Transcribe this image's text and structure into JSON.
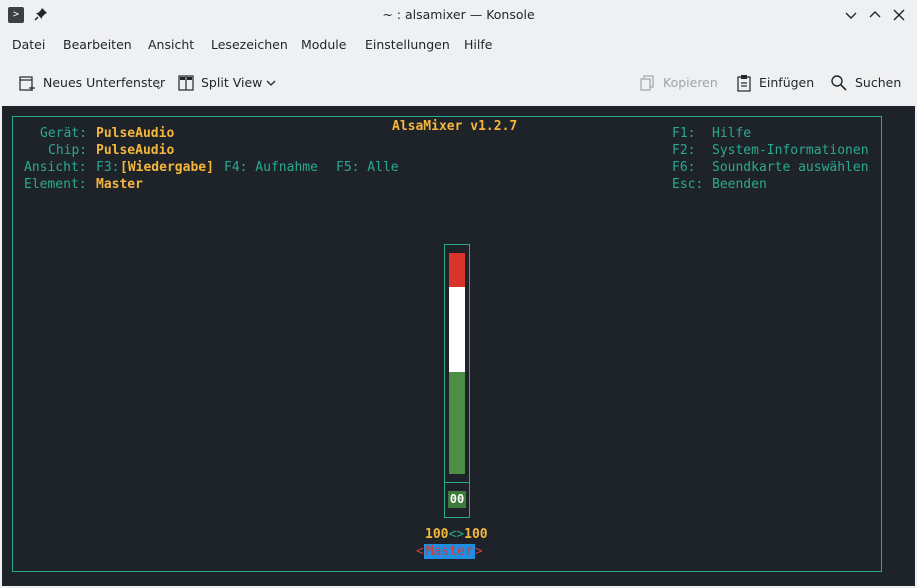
{
  "window": {
    "title": "~ : alsamixer — Konsole"
  },
  "menubar": {
    "items": [
      "Datei",
      "Bearbeiten",
      "Ansicht",
      "Lesezeichen",
      "Module",
      "Einstellungen",
      "Hilfe"
    ]
  },
  "toolbar": {
    "new_tab": "Neues Unterfenster",
    "split_view": "Split View",
    "copy": "Kopieren",
    "paste": "Einfügen",
    "search": "Suchen"
  },
  "alsamixer": {
    "title": "AlsaMixer v1.2.7",
    "device_label": "Gerät:",
    "device_value": "PulseAudio",
    "chip_label": "Chip:",
    "chip_value": "PulseAudio",
    "view_label": "Ansicht:",
    "view_f3": "F3:",
    "view_f3_value": "[Wiedergabe]",
    "view_f4": "F4: Aufnahme",
    "view_f5": "F5: Alle",
    "element_label": "Element:",
    "element_value": "Master",
    "keys": [
      {
        "key": "F1:",
        "desc": "Hilfe"
      },
      {
        "key": "F2:",
        "desc": "System-Informationen"
      },
      {
        "key": "F6:",
        "desc": "Soundkarte auswählen"
      },
      {
        "key": "Esc:",
        "desc": "Beenden"
      }
    ],
    "channel": {
      "mute_state": "00",
      "vol_left": "100",
      "vol_sep": "<>",
      "vol_right": "100",
      "name": "Master",
      "arrow_left": "<",
      "arrow_right": ">",
      "level_percent": 100
    }
  },
  "colors": {
    "terminal_bg": "#1e232a",
    "accent_cyan": "#2ba98f",
    "accent_yellow": "#f5b63b",
    "meter_red": "#d8342c",
    "meter_white": "#ffffff",
    "meter_green": "#4a8f45",
    "selected_bg": "#1f8de0"
  }
}
